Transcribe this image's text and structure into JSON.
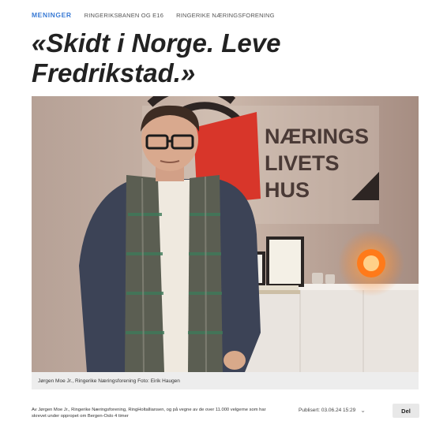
{
  "article": {
    "category": "MENINGER",
    "tags": [
      "RINGERIKSBANEN OG E16",
      "RINGERIKE NÆRINGSFORENING"
    ],
    "headline": "«Skidt i Norge. Leve Fredrikstad.»",
    "image": {
      "sign_text": [
        "NÆRINGS",
        "LIVETS",
        "HUS"
      ]
    },
    "caption": "Jørgen Moe Jr., Ringerike Næringsforening Foto: Eirik Haugen",
    "byline": "Av Jørgen Moe Jr., Ringerike Næringsforening, RingHoltalliansen, og på vegne av de over 11.000 velgerne som har skrevet under oppropet om Bergen-Oslo 4 timer",
    "published": "Publisert: 03.06.24 15:29",
    "share_label": "Del"
  },
  "colors": {
    "category": "#3a7bd5",
    "sign_red": "#d8362a",
    "sign_text": "#4a3a36",
    "lamp": "#ff7a1a"
  }
}
